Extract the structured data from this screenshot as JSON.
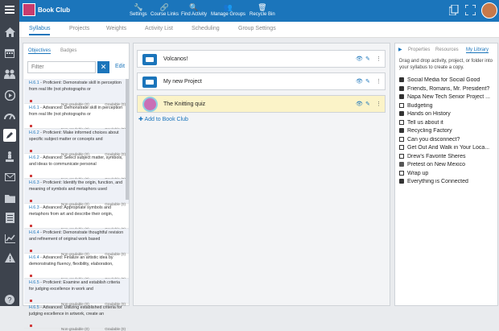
{
  "app": {
    "course_title": "Book Club"
  },
  "toolbar": {
    "buttons": [
      {
        "label": "Settings",
        "icon": "wrench-icon"
      },
      {
        "label": "Course Links",
        "icon": "link-icon"
      },
      {
        "label": "Find Activity",
        "icon": "search-icon"
      },
      {
        "label": "Manage Groups",
        "icon": "groups-icon"
      },
      {
        "label": "Recycle Bin",
        "icon": "recycle-bin-icon"
      }
    ]
  },
  "subnav": {
    "tabs": [
      "Syllabus",
      "Projects",
      "Weights",
      "Activity List",
      "Scheduling",
      "Group Settings"
    ],
    "active": "Syllabus"
  },
  "left": {
    "tabs": [
      "Objectives",
      "Badges"
    ],
    "filter_placeholder": "Filter",
    "edit": "Edit",
    "objectives": [
      {
        "code": "H.6.1",
        "text": "- Proficient: Demonstrate skill in perception from real life (not photographs or",
        "ng": "Non-gradable (0)",
        "g": "Gradable (0)"
      },
      {
        "code": "H.6.1",
        "text": "- Advanced: Demonstrate skill in perception from real life (not photographs or",
        "ng": "Non-gradable (0)",
        "g": "Gradable (0)"
      },
      {
        "code": "H.6.2",
        "text": "- Proficient: Make informed choices about specific subject matter or concepts and",
        "ng": "Non-gradable (0)",
        "g": "Gradable (0)"
      },
      {
        "code": "H.6.2",
        "text": "- Advanced: Select subject matter, symbols, and ideas to communicate personal",
        "ng": "Non-gradable (0)",
        "g": "Gradable (0)"
      },
      {
        "code": "H.6.3",
        "text": "- Proficient: Identify the origin, function, and meaning of symbols and metaphors used",
        "ng": "Non-gradable (0)",
        "g": "Gradable (0)"
      },
      {
        "code": "H.6.3",
        "text": "- Advanced: Appropriate symbols and metaphors from art and describe their origin,",
        "ng": "Non-gradable (0)",
        "g": "Gradable (0)"
      },
      {
        "code": "H.6.4",
        "text": "- Proficient: Demonstrate thoughtful revision and refinement of original work based",
        "ng": "Non-gradable (0)",
        "g": "Gradable (0)"
      },
      {
        "code": "H.6.4",
        "text": "- Advanced: Finalize an artistic idea by demonstrating fluency, flexibility, elaboration,",
        "ng": "Non-gradable (0)",
        "g": "Gradable (0)"
      },
      {
        "code": "H.6.5",
        "text": "- Proficient: Examine and establish criteria for judging excellence in work and",
        "ng": "Non-gradable (0)",
        "g": "Gradable (0)"
      },
      {
        "code": "H.6.5",
        "text": "- Advanced: Utilizing established criteria for judging excellence in artwork, create an",
        "ng": "Non-gradable (0)",
        "g": "Gradable (0)"
      }
    ]
  },
  "center": {
    "items": [
      {
        "title": "Volcanos!",
        "kind": "folder",
        "highlight": false
      },
      {
        "title": "My new Project",
        "kind": "folder",
        "highlight": false
      },
      {
        "title": "The Knitting quiz",
        "kind": "quiz",
        "highlight": true
      }
    ],
    "add_label": "Add to Book Club"
  },
  "right": {
    "tabs": [
      "Properties",
      "Resources",
      "My Library"
    ],
    "active": "My Library",
    "hint": "Drag and drop activity, project, or folder into your syllabus to create a copy.",
    "library": [
      {
        "label": "Social Media for Social Good",
        "kind": "folder"
      },
      {
        "label": "Friends, Romans, Mr. President?",
        "kind": "folder"
      },
      {
        "label": "Napa New Tech Senior Project ...",
        "kind": "folder"
      },
      {
        "label": "Budgeting",
        "kind": "doc"
      },
      {
        "label": "Hands on History",
        "kind": "folder"
      },
      {
        "label": "Tell us about it",
        "kind": "doc"
      },
      {
        "label": "Recycling Factory",
        "kind": "folder"
      },
      {
        "label": "Can you disconnect?",
        "kind": "doc"
      },
      {
        "label": "Get Out And Walk in Your Loca...",
        "kind": "doc"
      },
      {
        "label": "Drew's Favorite Sheres",
        "kind": "doc"
      },
      {
        "label": "Pretest on New Mexico",
        "kind": "quiz"
      },
      {
        "label": "Wrap up",
        "kind": "doc"
      },
      {
        "label": "Everything is Connected",
        "kind": "folder"
      }
    ]
  },
  "colors": {
    "brand": "#1b75bb",
    "nav": "#3d434d",
    "highlight": "#fbf3c8"
  }
}
